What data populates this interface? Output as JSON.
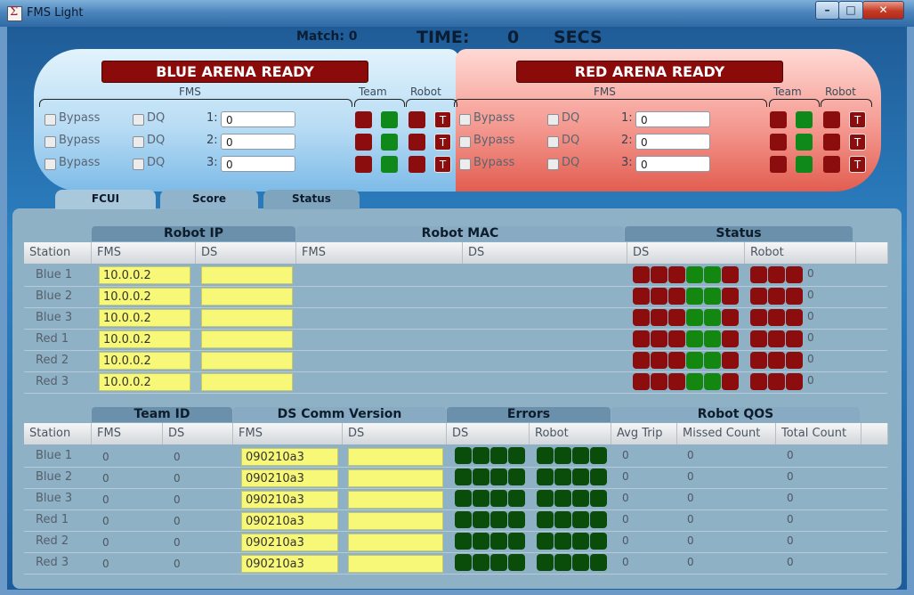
{
  "window": {
    "title": "FMS Light",
    "controls": [
      "–",
      "□",
      "✕"
    ]
  },
  "header": {
    "match_label": "Match: 0",
    "time_label": "TIME:",
    "time_value": "0",
    "secs_label": "SECS"
  },
  "blue_arena": {
    "banner": "BLUE ARENA READY",
    "groups": {
      "fms": "FMS",
      "team": "Team",
      "robot": "Robot"
    },
    "stations": [
      {
        "bypass": "Bypass",
        "dq": "DQ",
        "num": "1:",
        "team": "0"
      },
      {
        "bypass": "Bypass",
        "dq": "DQ",
        "num": "2:",
        "team": "0"
      },
      {
        "bypass": "Bypass",
        "dq": "DQ",
        "num": "3:",
        "team": "0"
      }
    ],
    "t_label": "T"
  },
  "red_arena": {
    "banner": "RED ARENA READY",
    "groups": {
      "fms": "FMS",
      "team": "Team",
      "robot": "Robot"
    },
    "stations": [
      {
        "bypass": "Bypass",
        "dq": "DQ",
        "num": "1:",
        "team": "0"
      },
      {
        "bypass": "Bypass",
        "dq": "DQ",
        "num": "2:",
        "team": "0"
      },
      {
        "bypass": "Bypass",
        "dq": "DQ",
        "num": "3:",
        "team": "0"
      }
    ],
    "t_label": "T"
  },
  "tabs": [
    "FCUI",
    "Score",
    "Status"
  ],
  "table1": {
    "groups": {
      "robot_ip": "Robot IP",
      "robot_mac": "Robot MAC",
      "status": "Status"
    },
    "columns": [
      "Station",
      "FMS",
      "DS",
      "FMS",
      "DS",
      "DS",
      "Robot"
    ],
    "rows": [
      {
        "station": "Blue  1",
        "ip_fms": "10.0.0.2",
        "count": "0"
      },
      {
        "station": "Blue  2",
        "ip_fms": "10.0.0.2",
        "count": "0"
      },
      {
        "station": "Blue  3",
        "ip_fms": "10.0.0.2",
        "count": "0"
      },
      {
        "station": "Red  1",
        "ip_fms": "10.0.0.2",
        "count": "0"
      },
      {
        "station": "Red  2",
        "ip_fms": "10.0.0.2",
        "count": "0"
      },
      {
        "station": "Red  3",
        "ip_fms": "10.0.0.2",
        "count": "0"
      }
    ]
  },
  "table2": {
    "groups": {
      "team_id": "Team ID",
      "ds_comm": "DS Comm Version",
      "errors": "Errors",
      "robot_qos": "Robot QOS"
    },
    "columns": [
      "Station",
      "FMS",
      "DS",
      "FMS",
      "DS",
      "DS",
      "Robot",
      "Avg Trip",
      "Missed Count",
      "Total Count"
    ],
    "rows": [
      {
        "station": "Blue  1",
        "fms": "0",
        "ds": "0",
        "version": "090210a3",
        "avg": "0",
        "missed": "0",
        "total": "0"
      },
      {
        "station": "Blue  2",
        "fms": "0",
        "ds": "0",
        "version": "090210a3",
        "avg": "0",
        "missed": "0",
        "total": "0"
      },
      {
        "station": "Blue  3",
        "fms": "0",
        "ds": "0",
        "version": "090210a3",
        "avg": "0",
        "missed": "0",
        "total": "0"
      },
      {
        "station": "Red  1",
        "fms": "0",
        "ds": "0",
        "version": "090210a3",
        "avg": "0",
        "missed": "0",
        "total": "0"
      },
      {
        "station": "Red  2",
        "fms": "0",
        "ds": "0",
        "version": "090210a3",
        "avg": "0",
        "missed": "0",
        "total": "0"
      },
      {
        "station": "Red  3",
        "fms": "0",
        "ds": "0",
        "version": "090210a3",
        "avg": "0",
        "missed": "0",
        "total": "0"
      }
    ]
  },
  "colors": {
    "led_red": "#8b0d0d",
    "led_green": "#0f8a1a",
    "led_dark_green": "#0a4d0a",
    "yellow_cell": "#f7f778",
    "blue_arena": "#b8dcf4",
    "red_arena": "#f49990"
  }
}
